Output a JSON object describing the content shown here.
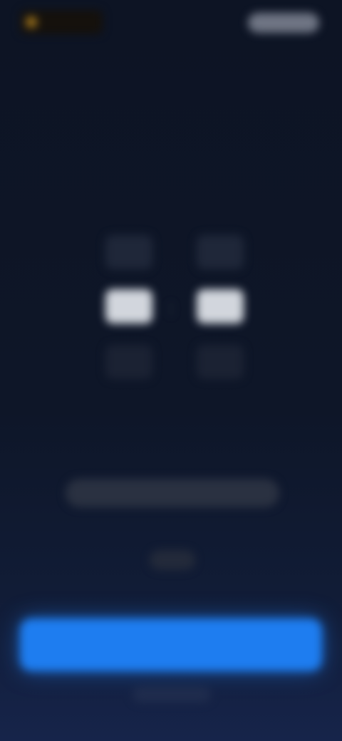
{
  "header": {
    "left_label": "",
    "right_label": ""
  },
  "picker": {
    "left": {
      "prev": "",
      "current": "",
      "next": ""
    },
    "right": {
      "prev": "",
      "current": "",
      "next": ""
    },
    "separator": ":"
  },
  "hint_text": "",
  "sub_text": "",
  "primary_button_label": "",
  "footer_text": "",
  "colors": {
    "background_top": "#0d1424",
    "background_bottom": "#16244a",
    "accent": "#1e7df0"
  },
  "icons": {
    "top_left": "brand-icon"
  }
}
